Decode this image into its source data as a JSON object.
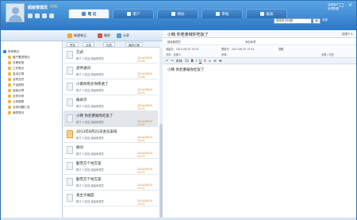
{
  "header": {
    "user_name": "超级管理员",
    "user_status": "(在线)",
    "right_line1": "当前用户",
    "right_line2": "系统设置",
    "search_placeholder": "搜索笔记标题",
    "search_button": "搜",
    "search_all": "全部"
  },
  "tabs": [
    {
      "label": "笔 记",
      "active": true
    },
    {
      "label": "客户",
      "active": false
    },
    {
      "label": "待办",
      "active": false
    },
    {
      "label": "审批",
      "active": false
    },
    {
      "label": "报表",
      "active": false
    }
  ],
  "window_controls": [
    "_",
    "□",
    "×"
  ],
  "toolbar": {
    "new_note": "新建笔记",
    "delete": "删除",
    "share": "分享"
  },
  "tree": {
    "root": "所有笔记",
    "items": [
      "客户跟进笔记",
      "日程安排",
      "工作笔记",
      "会议记录",
      "合同文件",
      "产品资料",
      "经验分享",
      "合作伙伴",
      "公司规章",
      "业务问题汇总",
      "我的笔记"
    ]
  },
  "list_filters": {
    "view": "预览",
    "all": "全部",
    "tags": "标签",
    "sort": "最新日期"
  },
  "notes": [
    {
      "title": "方式",
      "meta": "刚才  0 回复  超级管理员",
      "date": "2014/08/20 15:26"
    },
    {
      "title": "退件通问",
      "meta": "刚才  0 回复  超级管理员",
      "date": "2014/08/20 15:26"
    },
    {
      "title": "小黄你购买你惨透了",
      "meta": "刚才  0 回复  超级管理员",
      "date": "2014/08/20 15:25"
    },
    {
      "title": "报表示",
      "meta": "刚才  0 回复  超级管理员",
      "date": "2014/08/20 15:25"
    },
    {
      "title": "小韩 你老婆喊你吃饭了",
      "meta": "刚才  0 回复  超级管理员",
      "date": "2014/08/20 15:24"
    },
    {
      "title": "2013年8月21日会议安排",
      "meta": "刚才  0 回复  超级管理员",
      "date": "2014/08/20 15:24"
    },
    {
      "title": "顾问",
      "meta": "刚才  0 回复  超级管理员",
      "date": "2014/08/20 15:23"
    },
    {
      "title": "勤劳方个地方案",
      "meta": "刚才  0 回复  超级管理员",
      "date": "2014/08/20 15:23"
    },
    {
      "title": "勤劳方个地方案",
      "meta": "刚才  0 回复  超级管理员",
      "date": "2014/08/20 15:22"
    },
    {
      "title": "发主大幅度",
      "meta": "刚才  0 回复  超级管理员",
      "date": "2014/08/20 15:22"
    }
  ],
  "selected_note_index": 4,
  "editor": {
    "title": "小韩 你老婆喊你吃饭了",
    "title_right": "仅限个人",
    "author_label": "超级管理员",
    "tags_label": "添加标签",
    "field_create": "创建日：2014-08-20 15:24",
    "field_update": "更新日：2014-08-20 15:24",
    "field_remind": "提醒",
    "field_share": "共享：全部人",
    "field_source": "来源：",
    "field_right": "全屏 | 历史",
    "format_tools": [
      "↶",
      "↷",
      "宋体",
      "13",
      "B",
      "I",
      "U",
      "A",
      "≡",
      "☰",
      "⌘"
    ],
    "body": "小韩 你老婆喊你吃饭了"
  }
}
